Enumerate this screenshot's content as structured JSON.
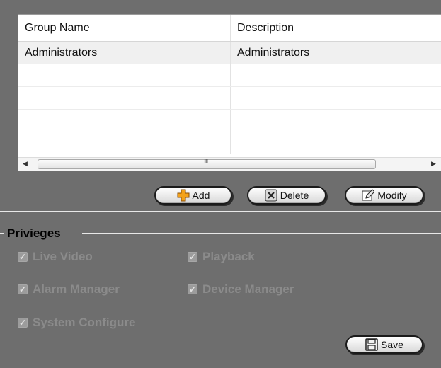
{
  "table": {
    "columns": [
      "Group Name",
      "Description"
    ],
    "rows": [
      {
        "group_name": "Administrators",
        "description": "Administrators"
      }
    ]
  },
  "scrollbar": {
    "grip": "III"
  },
  "actions": {
    "add_label": "Add",
    "delete_label": "Delete",
    "modify_label": "Modify"
  },
  "privileges": {
    "title": "Privieges",
    "items": [
      {
        "label": "Live Video",
        "checked": true,
        "enabled": false
      },
      {
        "label": "Playback",
        "checked": true,
        "enabled": false
      },
      {
        "label": "Alarm Manager",
        "checked": true,
        "enabled": false
      },
      {
        "label": "Device Manager",
        "checked": true,
        "enabled": false
      },
      {
        "label": "System Configure",
        "checked": true,
        "enabled": false
      }
    ],
    "save_label": "Save"
  },
  "colors": {
    "background": "#6e6e6e",
    "table_bg": "#ffffff",
    "add_icon": "#f3a21a",
    "disabled_text": "#8b8b8b"
  },
  "icons": [
    "plus-icon",
    "delete-x-icon",
    "edit-pencil-icon",
    "save-disk-icon",
    "scroll-left-icon",
    "scroll-right-icon"
  ]
}
